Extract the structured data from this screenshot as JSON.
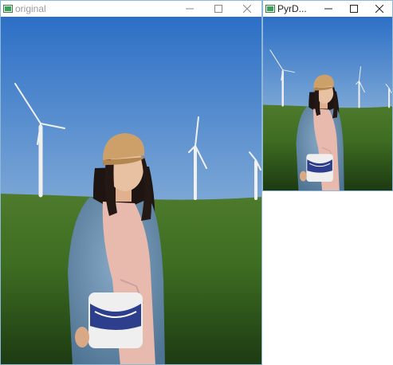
{
  "windows": {
    "original": {
      "title": "original",
      "controls": {
        "minimize": "minimize-icon",
        "maximize": "maximize-icon",
        "close": "close-icon"
      }
    },
    "pyrdown": {
      "title": "PyrD...",
      "controls": {
        "minimize": "minimize-icon",
        "maximize": "maximize-icon",
        "close": "close-icon"
      }
    }
  },
  "colors": {
    "sky_top": "#2f73c9",
    "sky_bottom": "#d9d3c0",
    "grass": "#3d6d22",
    "window_border": "#8fb7d6"
  }
}
